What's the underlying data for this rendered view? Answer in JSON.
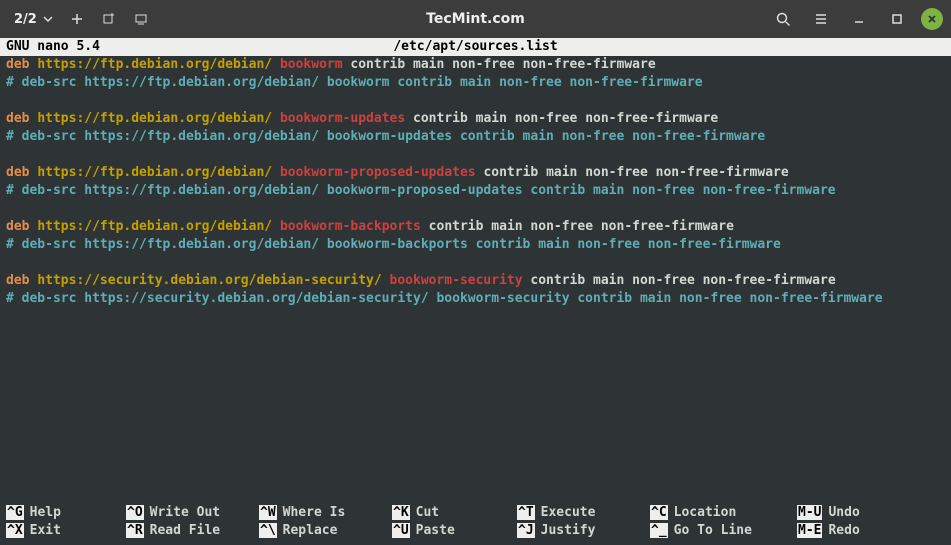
{
  "titlebar": {
    "tab_counter": "2/2",
    "title": "TecMint.com"
  },
  "nano": {
    "version": "GNU nano 5.4",
    "file": "/etc/apt/sources.list"
  },
  "sources": [
    {
      "type": "deb",
      "url": "https://ftp.debian.org/debian/",
      "suite": "bookworm",
      "tail": "contrib main non-free non-free-firmware"
    },
    {
      "type": "comment",
      "text": "# deb-src https://ftp.debian.org/debian/ bookworm contrib main non-free non-free-firmware"
    },
    {
      "type": "blank"
    },
    {
      "type": "deb",
      "url": "https://ftp.debian.org/debian/",
      "suite": "bookworm-updates",
      "tail": "contrib main non-free non-free-firmware"
    },
    {
      "type": "comment",
      "text": "# deb-src https://ftp.debian.org/debian/ bookworm-updates contrib main non-free non-free-firmware"
    },
    {
      "type": "blank"
    },
    {
      "type": "deb",
      "url": "https://ftp.debian.org/debian/",
      "suite": "bookworm-proposed-updates",
      "tail": "contrib main non-free non-free-firmware"
    },
    {
      "type": "comment",
      "text": "# deb-src https://ftp.debian.org/debian/ bookworm-proposed-updates contrib main non-free non-free-firmware"
    },
    {
      "type": "blank"
    },
    {
      "type": "deb",
      "url": "https://ftp.debian.org/debian/",
      "suite": "bookworm-backports",
      "tail": "contrib main non-free non-free-firmware"
    },
    {
      "type": "comment",
      "text": "# deb-src https://ftp.debian.org/debian/ bookworm-backports contrib main non-free non-free-firmware"
    },
    {
      "type": "blank"
    },
    {
      "type": "deb",
      "url": "https://security.debian.org/debian-security/",
      "suite": "bookworm-security",
      "tail": "contrib main non-free non-free-firmware"
    },
    {
      "type": "comment",
      "text": "# deb-src https://security.debian.org/debian-security/ bookworm-security contrib main non-free non-free-firmware"
    }
  ],
  "footer": {
    "row1": [
      {
        "key": "^G",
        "label": "Help"
      },
      {
        "key": "^O",
        "label": "Write Out"
      },
      {
        "key": "^W",
        "label": "Where Is"
      },
      {
        "key": "^K",
        "label": "Cut"
      },
      {
        "key": "^T",
        "label": "Execute"
      },
      {
        "key": "^C",
        "label": "Location"
      },
      {
        "key": "M-U",
        "label": "Undo"
      }
    ],
    "row2": [
      {
        "key": "^X",
        "label": "Exit"
      },
      {
        "key": "^R",
        "label": "Read File"
      },
      {
        "key": "^\\",
        "label": "Replace"
      },
      {
        "key": "^U",
        "label": "Paste"
      },
      {
        "key": "^J",
        "label": "Justify"
      },
      {
        "key": "^_",
        "label": "Go To Line"
      },
      {
        "key": "M-E",
        "label": "Redo"
      }
    ]
  }
}
